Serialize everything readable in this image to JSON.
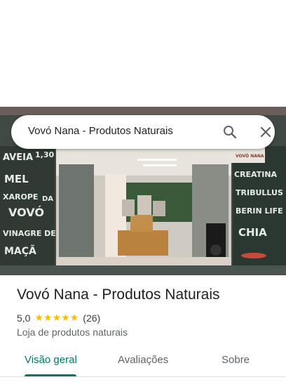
{
  "search": {
    "query": "Vovó Nana - Produtos Naturais"
  },
  "photo": {
    "chalkboard_left": [
      "AVEIA",
      "1,30",
      "MEL",
      "XAROPE",
      "DA",
      "VOVÓ",
      "VINAGRE DE",
      "MAÇÃ"
    ],
    "chalkboard_right": [
      "CREATINA",
      "TRIBULLUS",
      "BERIN LIFE",
      "CHIA"
    ],
    "sign_right": "VOVÓ NANA"
  },
  "place": {
    "title": "Vovó Nana - Produtos Naturais",
    "rating": "5,0",
    "stars": 5,
    "review_count": "(26)",
    "category": "Loja de produtos naturais"
  },
  "tabs": [
    {
      "label": "Visão geral",
      "active": true
    },
    {
      "label": "Avaliações",
      "active": false
    },
    {
      "label": "Sobre",
      "active": false
    }
  ],
  "colors": {
    "accent": "#00796b",
    "star": "#fbbc04"
  },
  "icons": {
    "search": "search-icon",
    "close": "close-icon"
  }
}
